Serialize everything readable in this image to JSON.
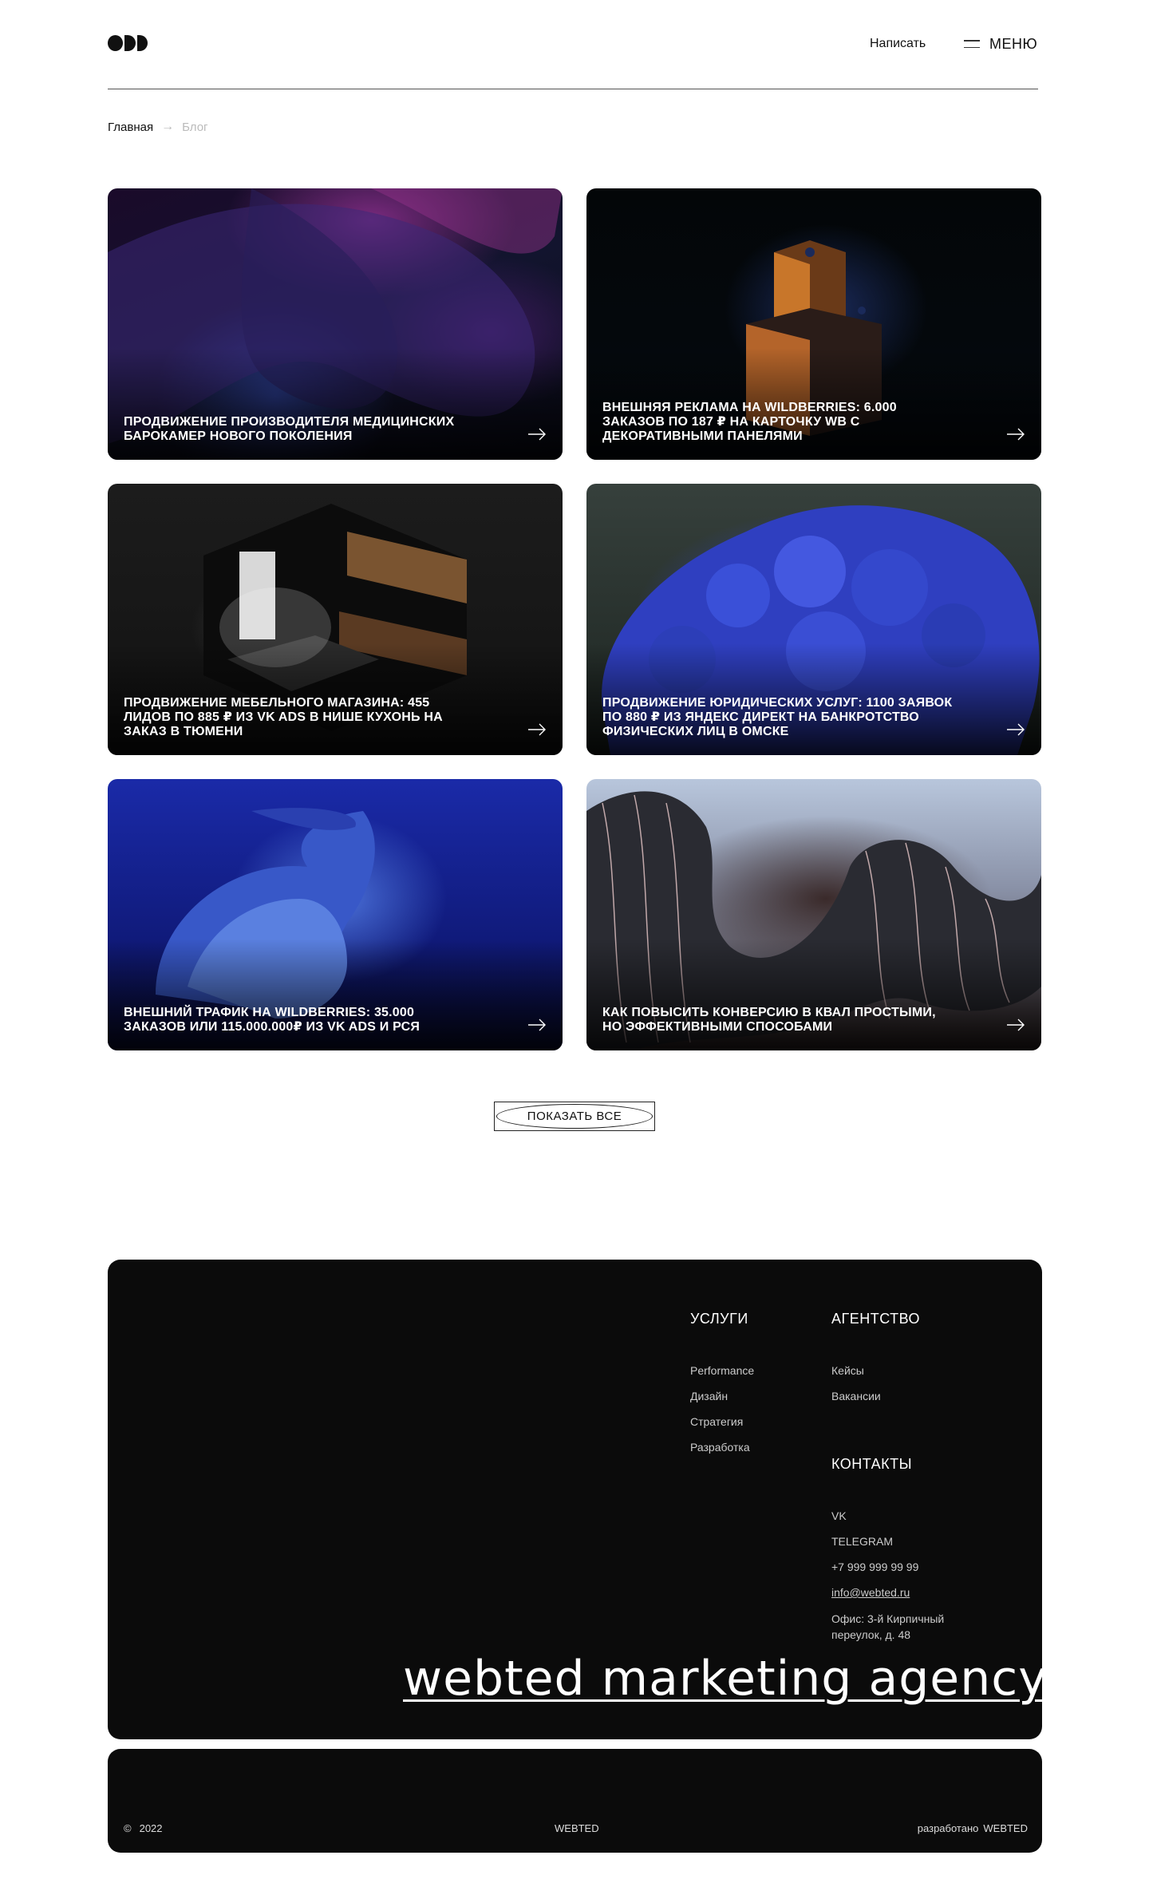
{
  "header": {
    "write_label": "Написать",
    "menu_label": "МЕНЮ"
  },
  "breadcrumb": {
    "home": "Главная",
    "current": "Блог"
  },
  "cards": [
    {
      "title": "ПРОДВИЖЕНИЕ ПРОИЗВОДИТЕЛЯ МЕДИЦИНСКИХ БАРОКАМЕР НОВОГО ПОКОЛЕНИЯ"
    },
    {
      "title": "ВНЕШНЯЯ РЕКЛАМА НА WILDBERRIES: 6.000 ЗАКАЗОВ ПО 187 ₽ НА КАРТОЧКУ WB С ДЕКОРАТИВНЫМИ ПАНЕЛЯМИ"
    },
    {
      "title": "ПРОДВИЖЕНИЕ МЕБЕЛЬНОГО МАГАЗИНА: 455 ЛИДОВ ПО 885 ₽ ИЗ VK ADS В НИШЕ КУХОНЬ НА ЗАКАЗ В ТЮМЕНИ"
    },
    {
      "title": "ПРОДВИЖЕНИЕ ЮРИДИЧЕСКИХ УСЛУГ: 1100 ЗАЯВОК ПО 880 ₽ ИЗ ЯНДЕКС ДИРЕКТ НА БАНКРОТСТВО ФИЗИЧЕСКИХ ЛИЦ В ОМСКЕ"
    },
    {
      "title": "ВНЕШНИЙ ТРАФИК НА WILDBERRIES: 35.000 ЗАКАЗОВ ИЛИ 115.000.000₽ ИЗ VK ADS И РСЯ"
    },
    {
      "title": "КАК ПОВЫСИТЬ КОНВЕРСИЮ В КВАЛ ПРОСТЫМИ, НО ЭФФЕКТИВНЫМИ СПОСОБАМИ"
    }
  ],
  "show_all_label": "ПОКАЗАТЬ ВСЕ",
  "footer": {
    "services": {
      "heading": "УСЛУГИ",
      "items": [
        "Performance",
        "Дизайн",
        "Стратегия",
        "Разработка"
      ]
    },
    "agency": {
      "heading": "АГЕНТСТВО",
      "items": [
        "Кейсы",
        "Вакансии"
      ]
    },
    "contacts": {
      "heading": "КОНТАКТЫ",
      "vk": "VK",
      "telegram": "TELEGRAM",
      "phone": "+7 999 999 99 99",
      "email": "info@webted.ru",
      "address": "Офис: 3-й Кирпичный переулок, д. 48"
    },
    "slogan": "webted marketing agency"
  },
  "footer_bottom": {
    "copyright_symbol": "©",
    "year": "2022",
    "brand": "WEBTED",
    "made_by_label": "разработано",
    "made_by_brand": "WEBTED"
  }
}
